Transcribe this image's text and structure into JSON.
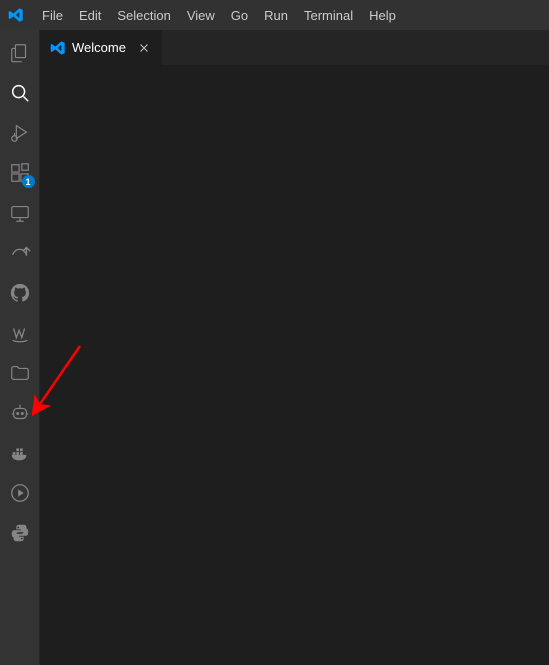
{
  "menubar": {
    "items": [
      "File",
      "Edit",
      "Selection",
      "View",
      "Go",
      "Run",
      "Terminal",
      "Help"
    ]
  },
  "activity_bar": {
    "items": [
      {
        "name": "explorer",
        "icon": "files-icon"
      },
      {
        "name": "search",
        "icon": "search-icon",
        "active": true
      },
      {
        "name": "run-debug",
        "icon": "debug-icon"
      },
      {
        "name": "extensions",
        "icon": "extensions-icon",
        "badge": "1"
      },
      {
        "name": "remote",
        "icon": "remote-icon"
      },
      {
        "name": "share",
        "icon": "share-icon"
      },
      {
        "name": "github",
        "icon": "github-icon"
      },
      {
        "name": "aws",
        "icon": "aws-icon"
      },
      {
        "name": "folders",
        "icon": "folder-icon"
      },
      {
        "name": "copilot",
        "icon": "robot-icon"
      },
      {
        "name": "docker",
        "icon": "docker-icon"
      },
      {
        "name": "actions",
        "icon": "circle-play-icon"
      },
      {
        "name": "python",
        "icon": "python-icon"
      }
    ]
  },
  "tabs": [
    {
      "label": "Welcome",
      "icon": "vscode-icon"
    }
  ],
  "annotation": {
    "type": "arrow",
    "color": "#ff0000"
  }
}
